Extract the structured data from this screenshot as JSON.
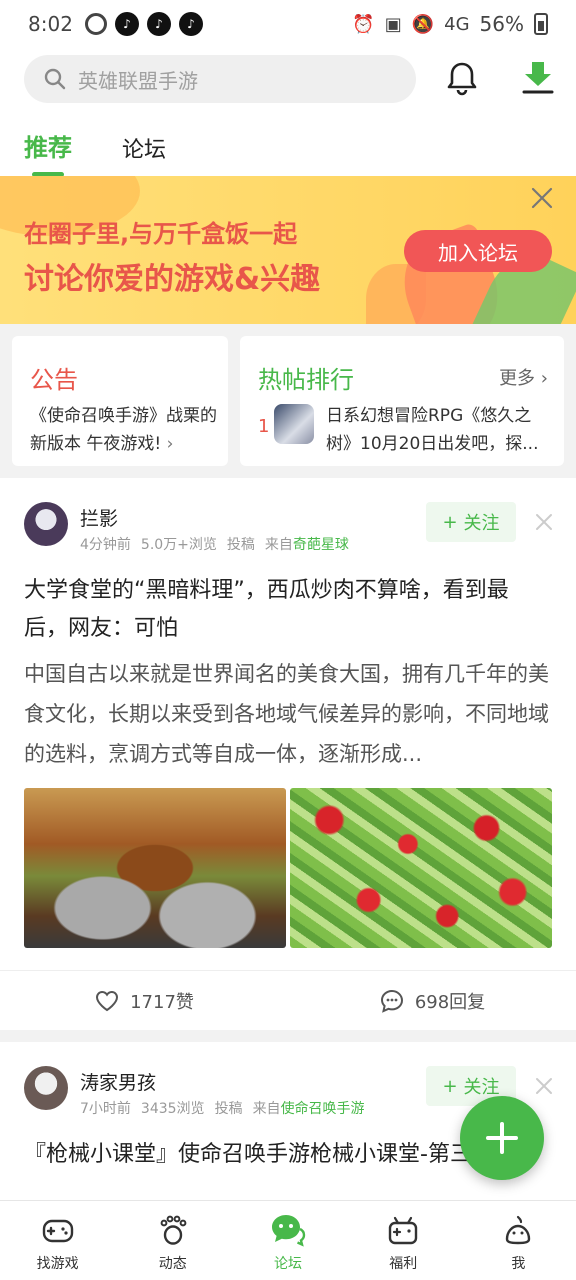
{
  "status_bar": {
    "time": "8:02",
    "battery": "56%",
    "network": "4G",
    "app_badge": "♪"
  },
  "search": {
    "placeholder": "英雄联盟手游"
  },
  "tabs": [
    {
      "label": "推荐",
      "active": true
    },
    {
      "label": "论坛",
      "active": false
    }
  ],
  "banner": {
    "line1": "在圈子里,与万千盒饭一起",
    "line2": "讨论你爱的游戏&兴趣",
    "button": "加入论坛"
  },
  "notice": {
    "title": "公告",
    "text": "《使命召唤手游》战栗的新版本 午夜游戏!"
  },
  "hot": {
    "title": "热帖排行",
    "more": "更多",
    "rank": "1",
    "text": "日系幻想冒险RPG《悠久之树》10月20日出发吧，探..."
  },
  "posts": [
    {
      "author": "拦影",
      "time": "4分钟前",
      "views": "5.0万+浏览",
      "type": "投稿",
      "from_prefix": "来自",
      "from": "奇葩星球",
      "follow": "关注",
      "title": "大学食堂的“黑暗料理”，西瓜炒肉不算啥，看到最后，网友：可怕",
      "excerpt": "中国自古以来就是世界闻名的美食大国，拥有几千年的美食文化，长期以来受到各地域气候差异的影响，不同地域的选料，烹调方式等自成一体，逐渐形成...",
      "likes": "1717赞",
      "replies": "698回复"
    },
    {
      "author": "涛家男孩",
      "time": "7小时前",
      "views": "3435浏览",
      "type": "投稿",
      "from_prefix": "来自",
      "from": "使命召唤手游",
      "follow": "关注",
      "title": "『枪械小课堂』使命召唤手游枪械小课堂-第三节 课"
    }
  ],
  "bottom_nav": [
    {
      "label": "找游戏",
      "icon": "gamepad-icon"
    },
    {
      "label": "动态",
      "icon": "footprint-icon"
    },
    {
      "label": "论坛",
      "icon": "chat-bubble-icon",
      "active": true
    },
    {
      "label": "福利",
      "icon": "gift-icon"
    },
    {
      "label": "我",
      "icon": "profile-icon"
    }
  ],
  "colors": {
    "accent": "#48b84a",
    "alert": "#e8564a",
    "banner_bg": "#ffd25a"
  }
}
